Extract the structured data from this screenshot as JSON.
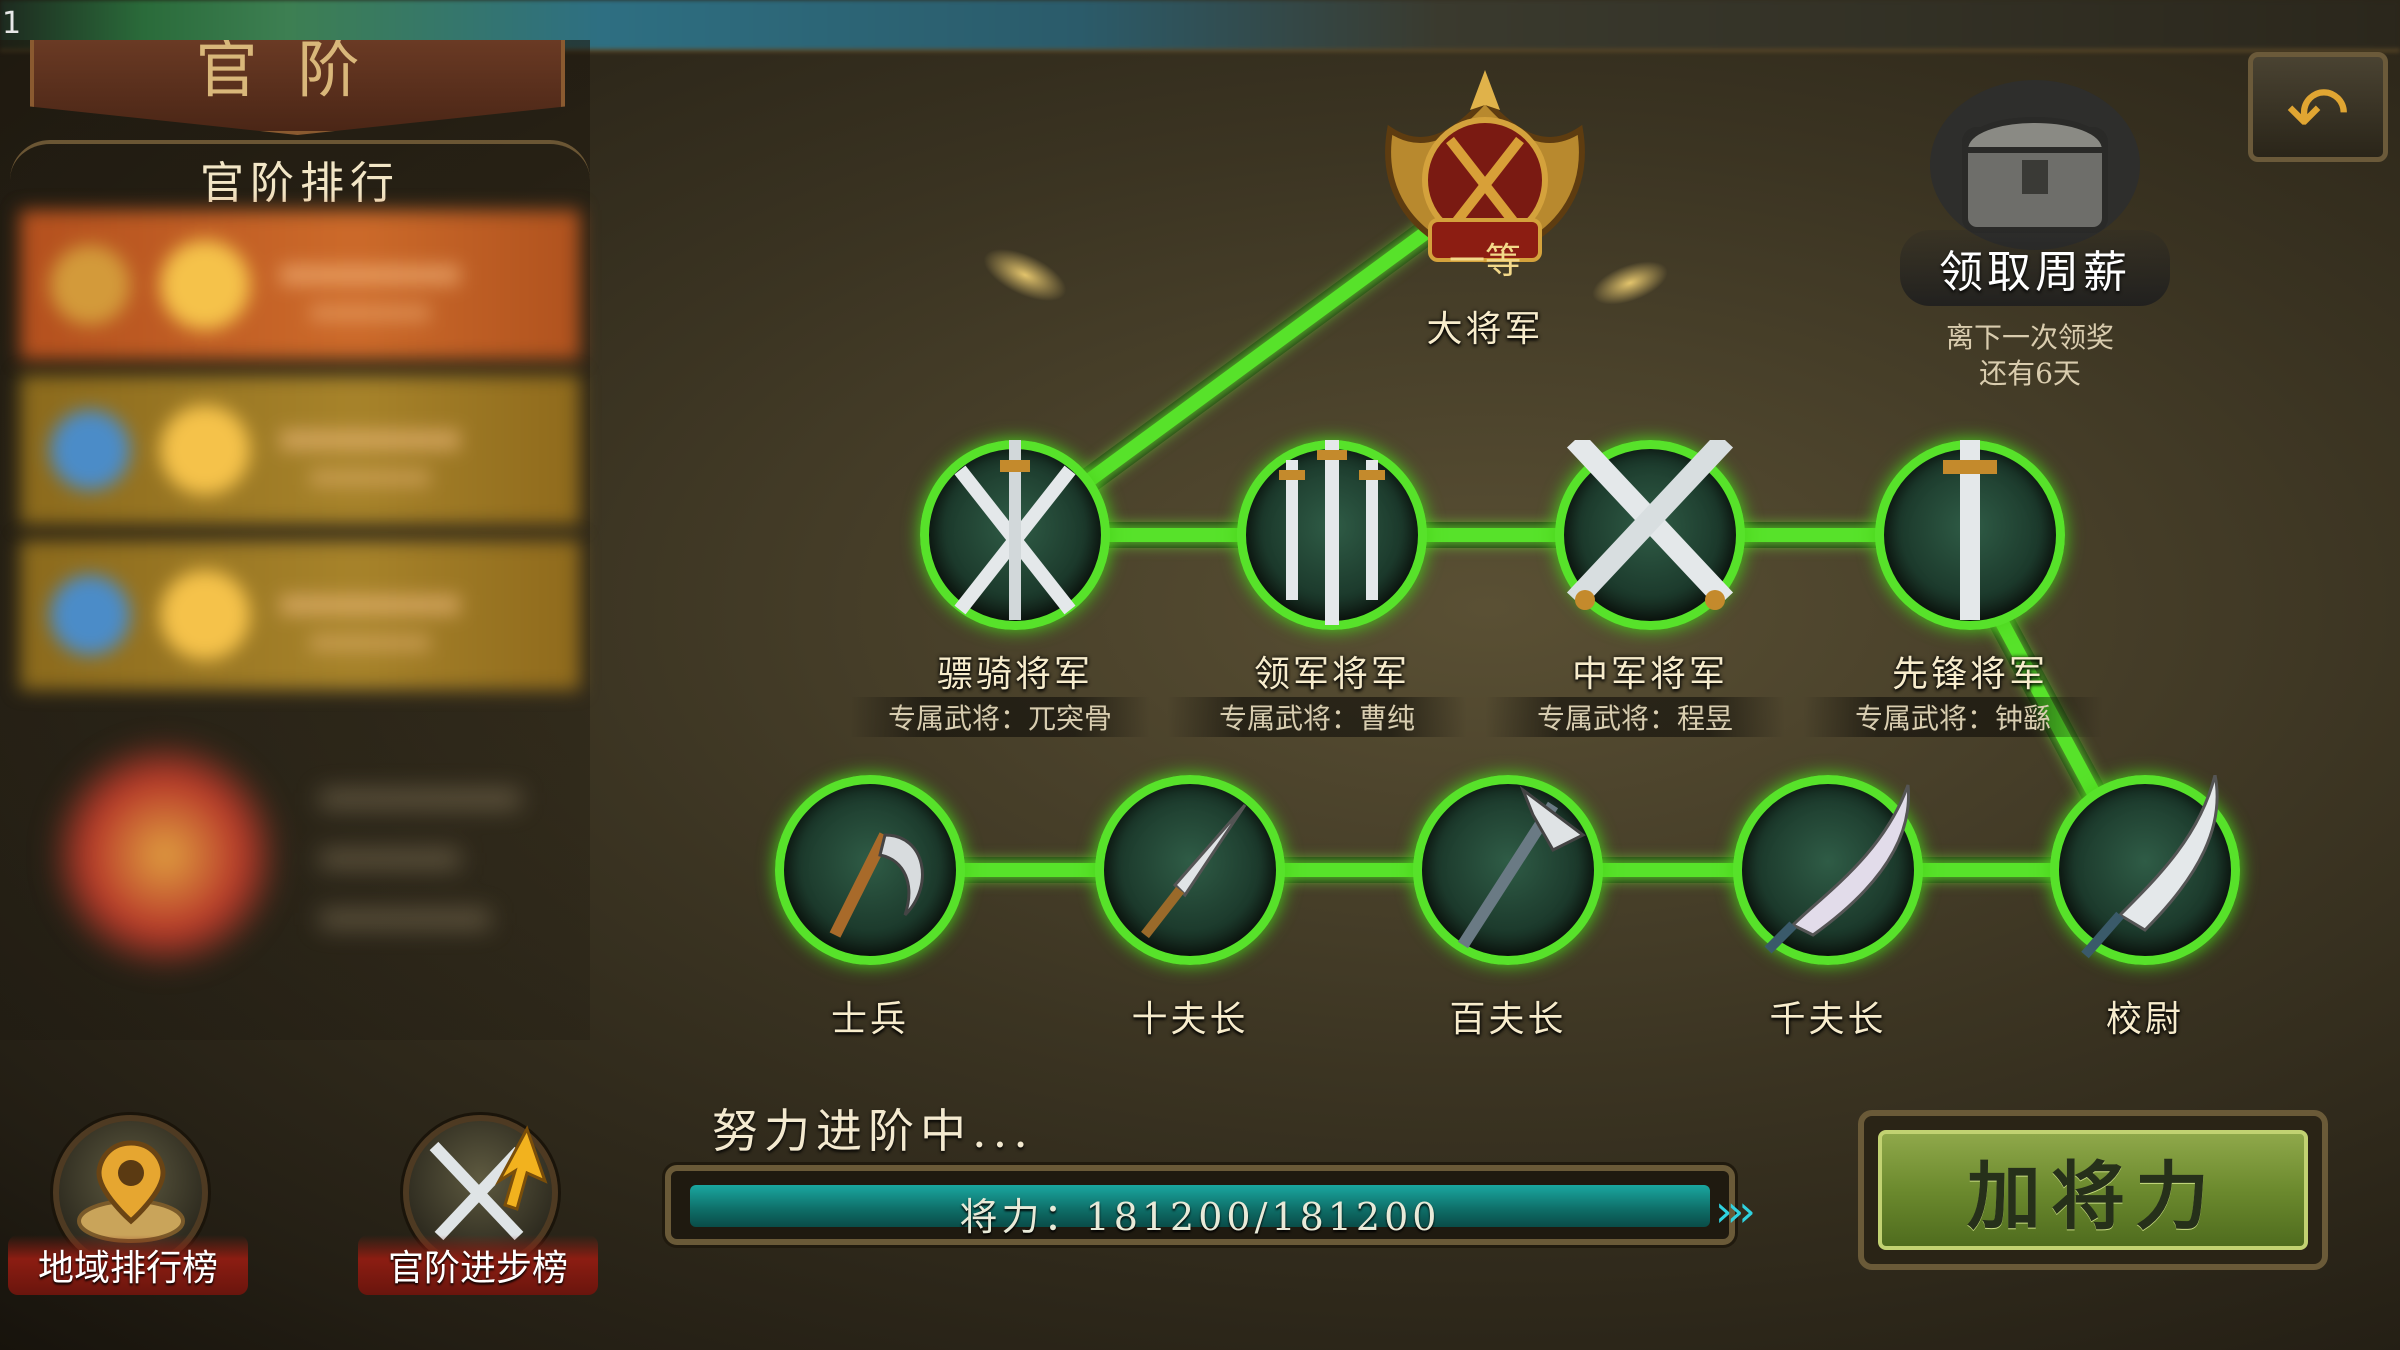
{
  "status_bar": {
    "corner_text": "1"
  },
  "panel": {
    "banner_title": "官阶",
    "ranking_title": "官阶排行"
  },
  "bottom_buttons": {
    "regional_ranking": "地域排行榜",
    "rank_progress": "官阶进步榜"
  },
  "top_rank": {
    "badge": "一等",
    "label": "大将军"
  },
  "generals": [
    {
      "label": "骠骑将军",
      "hero": "专属武将：兀突骨"
    },
    {
      "label": "领军将军",
      "hero": "专属武将：曹纯"
    },
    {
      "label": "中军将军",
      "hero": "专属武将：程昱"
    },
    {
      "label": "先锋将军",
      "hero": "专属武将：钟繇"
    }
  ],
  "lower_ranks": [
    {
      "label": "士兵"
    },
    {
      "label": "十夫长"
    },
    {
      "label": "百夫长"
    },
    {
      "label": "千夫长"
    },
    {
      "label": "校尉"
    }
  ],
  "salary": {
    "button": "领取周薪",
    "note_line1": "离下一次领奖",
    "note_line2": "还有6天"
  },
  "progress": {
    "caption": "努力进阶中...",
    "text": "将力：181200/181200",
    "current": 181200,
    "max": 181200,
    "fraction": 1.0
  },
  "actions": {
    "add_power": "加将力",
    "back_icon": "back-arrow-icon"
  },
  "colors": {
    "path_green": "#57e22a",
    "progress_teal": "#1aa7a0",
    "button_green": "#6c8a2e",
    "banner_red": "#8c1d12"
  }
}
